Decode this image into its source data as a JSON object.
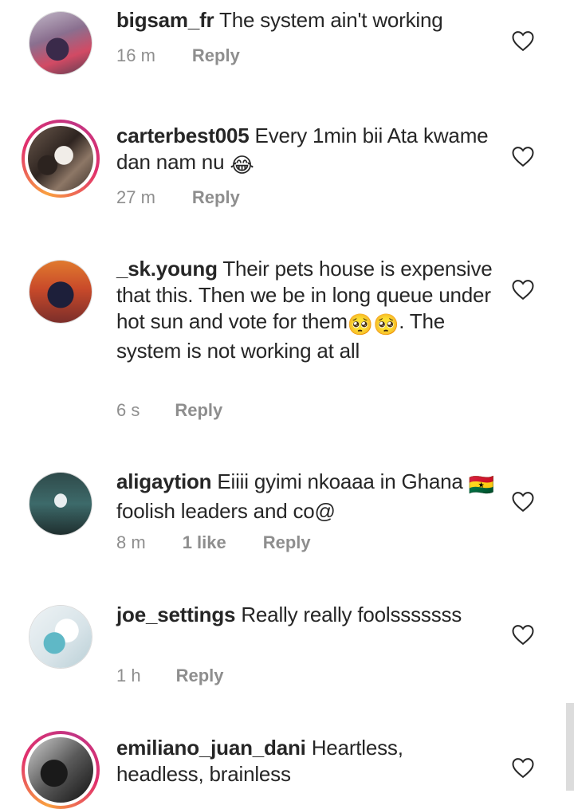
{
  "colors": {
    "text": "#262626",
    "secondary": "#8e8e8e",
    "story_ring": "#e1306c"
  },
  "comments": [
    {
      "username": "bigsam_fr",
      "text": "The system ain't working",
      "time": "16 m",
      "likes": "",
      "reply": "Reply"
    },
    {
      "username": "carterbest005",
      "text": "Every 1min bii Ata kwame dan nam nu",
      "emoji": "😂",
      "time": "27 m",
      "likes": "",
      "reply": "Reply"
    },
    {
      "username": "_sk.young",
      "text_a": "Their pets house is expensive that this.  Then we be in long queue under hot sun and vote for them",
      "emoji": "🥺🥺",
      "text_b": ". The system is not working at all",
      "time": "6 s",
      "likes": "",
      "reply": "Reply"
    },
    {
      "username": "aligaytion",
      "text_a": "Eiiii gyimi nkoaaa in Ghana",
      "emoji": "🇬🇭",
      "text_b": " foolish leaders and co@",
      "time": "8 m",
      "likes": "1 like",
      "reply": "Reply"
    },
    {
      "username": "joe_settings",
      "text": "Really really foolsssssss",
      "time": "1 h",
      "likes": "",
      "reply": "Reply"
    },
    {
      "username": "emiliano_juan_dani",
      "text": "Heartless, headless, brainless",
      "time": "",
      "likes": "",
      "reply": ""
    }
  ],
  "icons": {
    "like": "heart-outline-icon"
  }
}
